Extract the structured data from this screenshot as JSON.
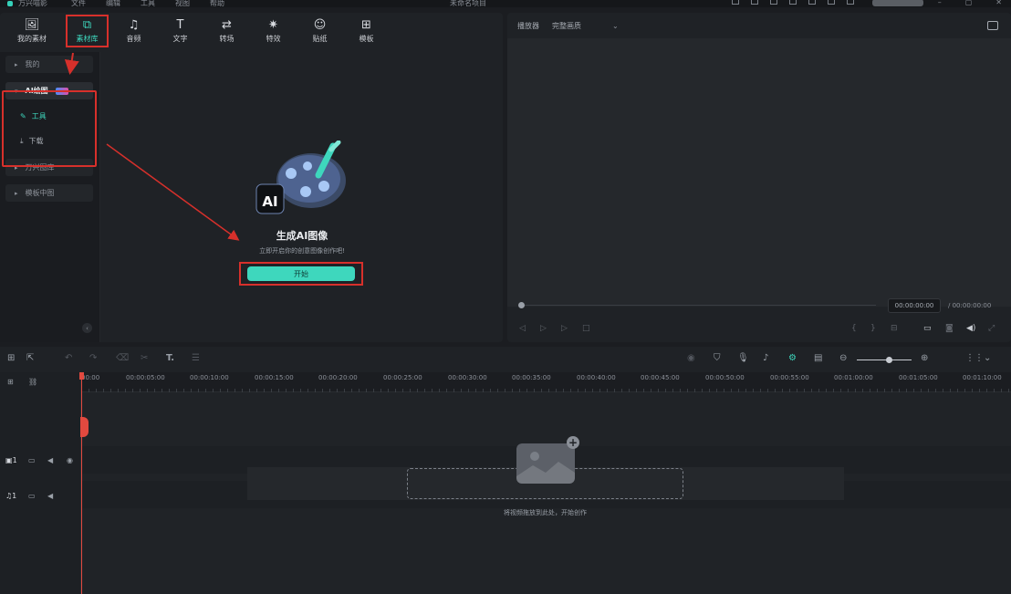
{
  "menubar": {
    "app_name": "万兴喵影",
    "menus": [
      "文件",
      "编辑",
      "工具",
      "视图",
      "帮助"
    ],
    "doc_title": "未命名项目"
  },
  "toolbar": {
    "items": [
      {
        "label": "我的素材",
        "icon": "image-icon"
      },
      {
        "label": "素材库",
        "icon": "library-icon",
        "active": true
      },
      {
        "label": "音频",
        "icon": "music-note-icon"
      },
      {
        "label": "文字",
        "icon": "text-icon"
      },
      {
        "label": "转场",
        "icon": "transition-icon"
      },
      {
        "label": "特效",
        "icon": "sparkle-icon"
      },
      {
        "label": "贴纸",
        "icon": "sticker-icon"
      },
      {
        "label": "模板",
        "icon": "template-icon"
      }
    ]
  },
  "library": {
    "mine": "我的",
    "ai": "AI绘图",
    "ai_badge": "AI",
    "tools": "工具",
    "download": "下载",
    "stock": "万兴图库",
    "template": "模板中图"
  },
  "ai_panel": {
    "title": "生成AI图像",
    "subtitle": "立即开启你的创意图像创作吧!",
    "start_label": "开始"
  },
  "player": {
    "label": "播放器",
    "quality": "完整画质",
    "timecode_current": "00:00:00:00",
    "timecode_total": "00:00:00:00"
  },
  "ruler": {
    "ticks": [
      "00:00",
      "00:00:05:00",
      "00:00:10:00",
      "00:00:15:00",
      "00:00:20:00",
      "00:00:25:00",
      "00:00:30:00",
      "00:00:35:00",
      "00:00:40:00",
      "00:00:45:00",
      "00:00:50:00",
      "00:00:55:00",
      "00:01:00:00",
      "00:01:05:00",
      "00:01:10:00"
    ]
  },
  "tracks": {
    "video_label": "1",
    "audio_label": "1"
  },
  "dropzone": {
    "hint": "将视频拖放到此处，开始创作"
  },
  "colors": {
    "accent": "#3ed7bd",
    "highlight_box": "#d7302b",
    "playhead": "#e2493f"
  }
}
